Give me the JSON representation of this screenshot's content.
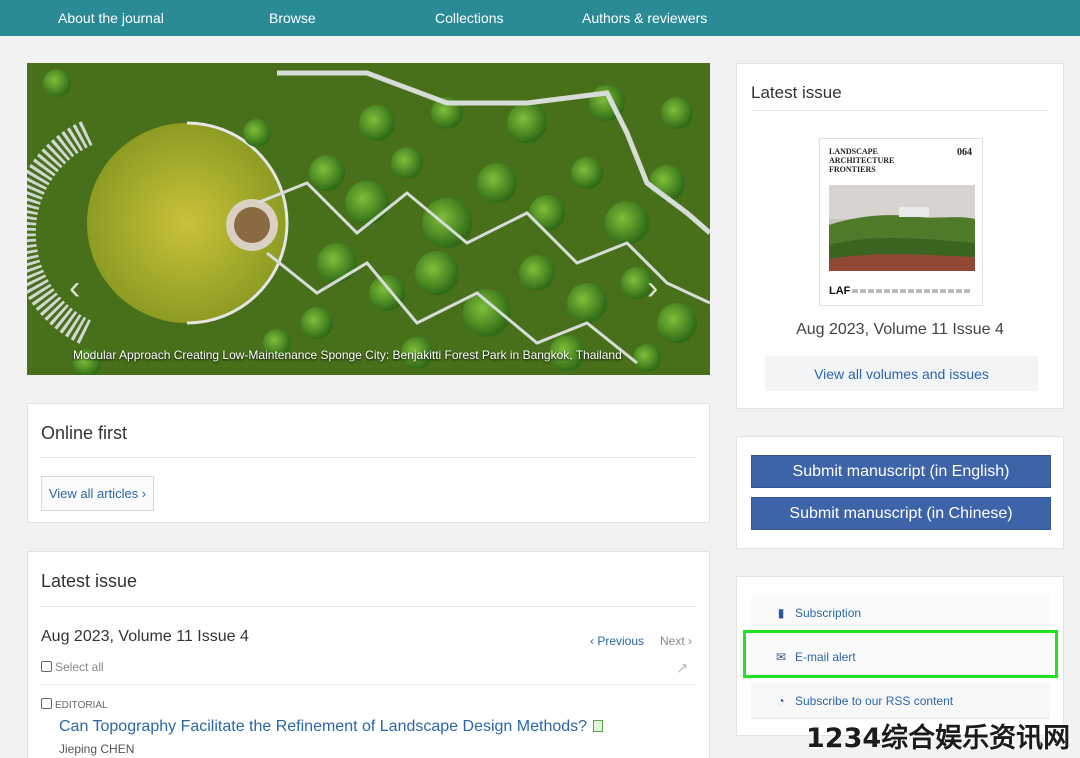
{
  "nav": {
    "items": [
      "About the journal",
      "Browse",
      "Collections",
      "Authors & reviewers"
    ]
  },
  "hero": {
    "caption": "Modular Approach Creating Low-Maintenance Sponge City: Benjakitti Forest Park in Bangkok, Thailand",
    "prev_arrow": "‹",
    "next_arrow": "›"
  },
  "online_first": {
    "title": "Online first",
    "view_all": "View all articles ›"
  },
  "latest_issue_main": {
    "title": "Latest issue",
    "issue_label": "Aug 2023, Volume 11 Issue 4",
    "previous": "‹ Previous",
    "next": "Next ›",
    "select_all": "Select all",
    "articles": [
      {
        "type": "EDITORIAL",
        "title": "Can Topography Facilitate the Refinement of Landscape Design Methods?",
        "author": "Jieping CHEN"
      }
    ]
  },
  "sidebar_latest": {
    "title": "Latest issue",
    "cover": {
      "journal_line1": "LANDSCAPE",
      "journal_line2": "ARCHITECTURE",
      "journal_line3": "FRONTIERS",
      "number": "064",
      "logo": "LAF"
    },
    "issue_label": "Aug 2023, Volume 11 Issue 4",
    "view_all": "View all volumes and issues"
  },
  "submit": {
    "english": "Submit manuscript (in English)",
    "chinese": "Submit manuscript (in Chinese)"
  },
  "services": {
    "items": [
      {
        "label": "Subscription",
        "icon": "book-icon"
      },
      {
        "label": "E-mail alert",
        "icon": "envelope-icon"
      },
      {
        "label": "Subscribe to our RSS content",
        "icon": "rss-icon"
      }
    ]
  },
  "watermark": "1234综合娱乐资讯网",
  "colors": {
    "nav_bg": "#2a8a96",
    "link": "#2b67a8",
    "button_blue": "#3d64a8",
    "highlight": "#22e322"
  }
}
